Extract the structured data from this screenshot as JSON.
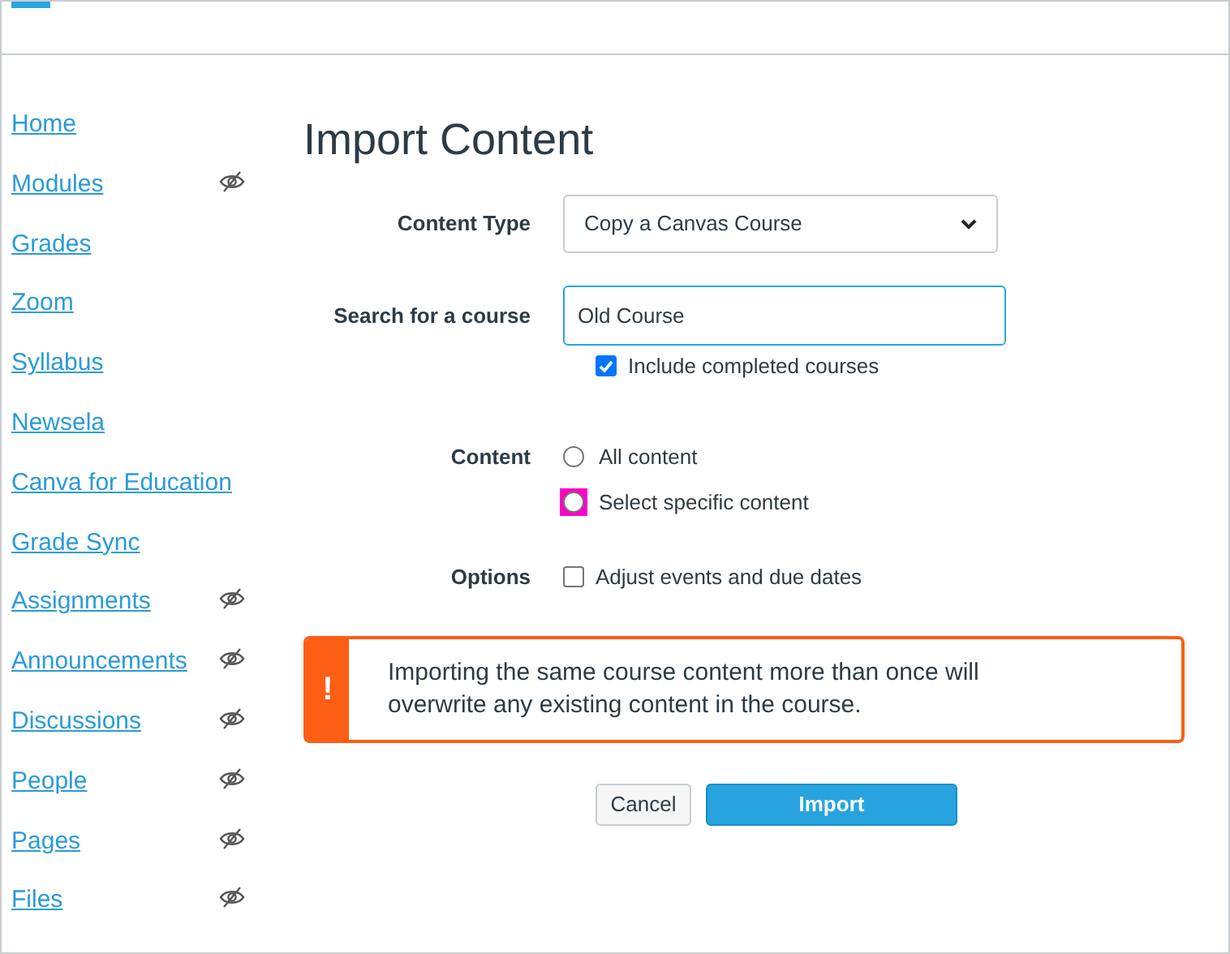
{
  "sidebar": {
    "items": [
      {
        "label": "Home",
        "hidden": false
      },
      {
        "label": "Modules",
        "hidden": true
      },
      {
        "label": "Grades",
        "hidden": false
      },
      {
        "label": "Zoom",
        "hidden": false
      },
      {
        "label": "Syllabus",
        "hidden": false
      },
      {
        "label": "Newsela",
        "hidden": false
      },
      {
        "label": "Canva for Education",
        "hidden": false
      },
      {
        "label": "Grade Sync",
        "hidden": false
      },
      {
        "label": "Assignments",
        "hidden": true
      },
      {
        "label": "Announcements",
        "hidden": true
      },
      {
        "label": "Discussions",
        "hidden": true
      },
      {
        "label": "People",
        "hidden": true
      },
      {
        "label": "Pages",
        "hidden": true
      },
      {
        "label": "Files",
        "hidden": true
      }
    ]
  },
  "page_title": "Import Content",
  "form": {
    "content_type": {
      "label": "Content Type",
      "value": "Copy a Canvas Course"
    },
    "search": {
      "label": "Search for a course",
      "value": "Old Course",
      "include_completed": {
        "label": "Include completed courses",
        "checked": true
      }
    },
    "content": {
      "label": "Content",
      "options": [
        {
          "label": "All content",
          "selected": false,
          "highlighted": false
        },
        {
          "label": "Select specific content",
          "selected": false,
          "highlighted": true
        }
      ]
    },
    "options": {
      "label": "Options",
      "items": [
        {
          "label": "Adjust events and due dates",
          "checked": false
        }
      ]
    }
  },
  "alert": {
    "icon_text": "!",
    "message": "Importing the same course content more than once will overwrite any existing content in the course."
  },
  "buttons": [
    {
      "label": "Cancel",
      "kind": "secondary"
    },
    {
      "label": "Import",
      "kind": "primary"
    }
  ]
}
